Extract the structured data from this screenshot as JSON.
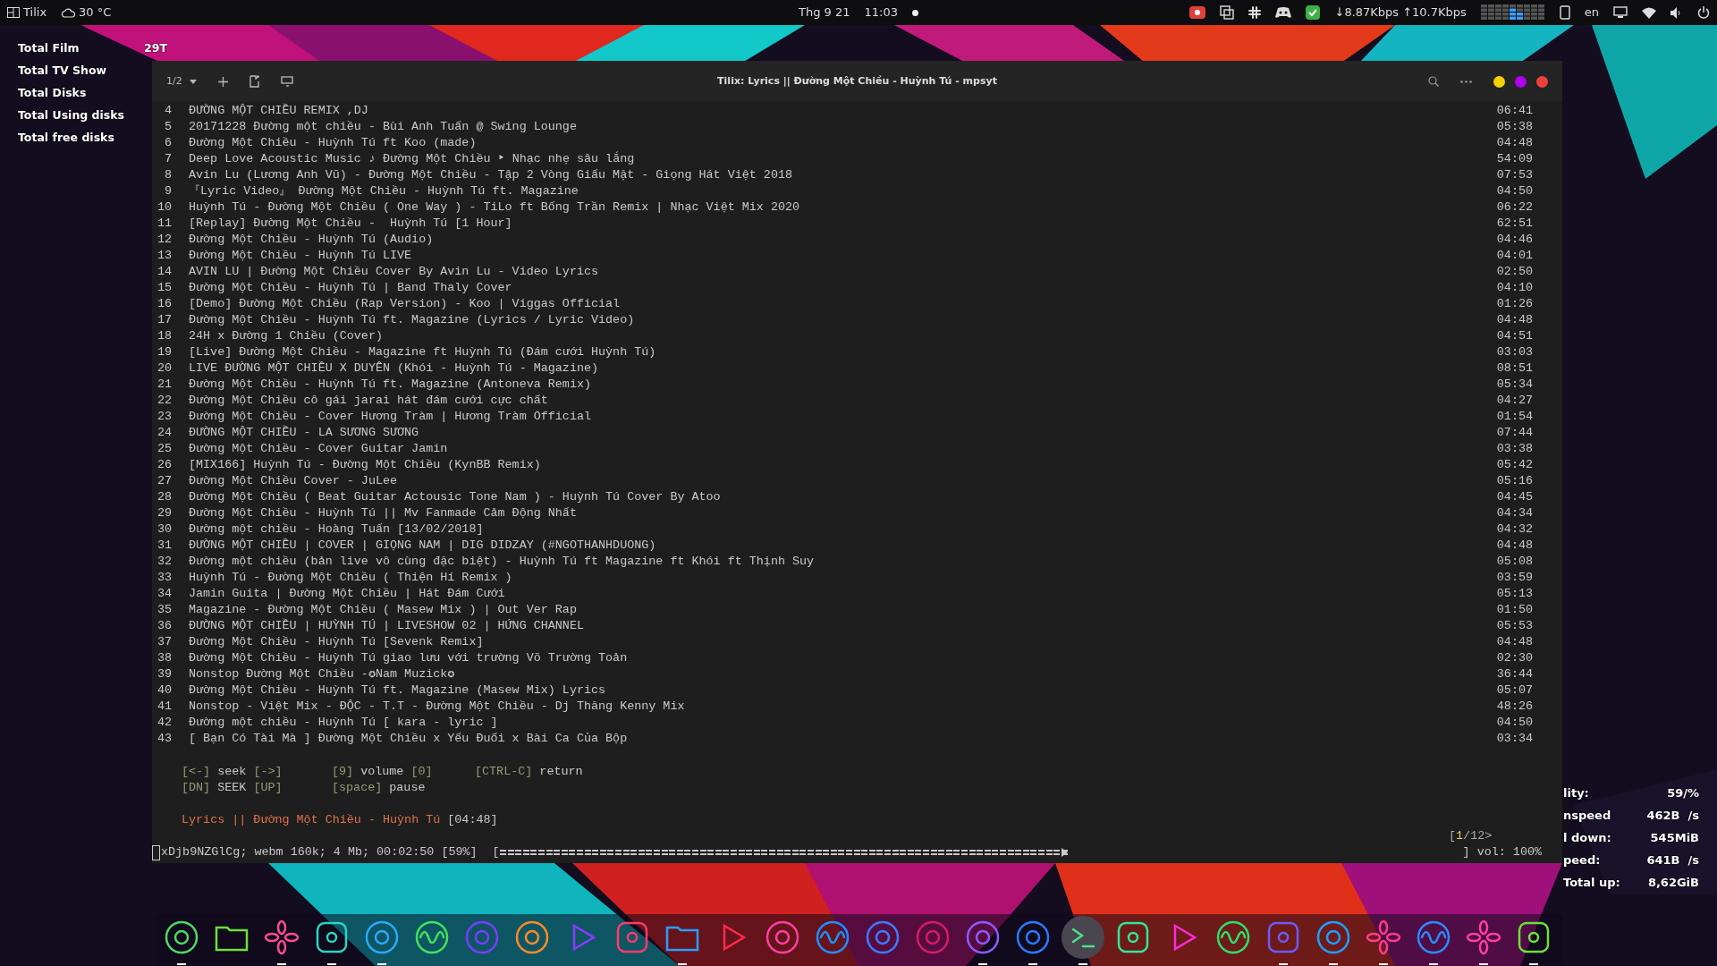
{
  "top_bar": {
    "app": "Tilix",
    "weather": "30 °C",
    "date": "Thg 9 21",
    "time": "11:03",
    "net_down": "↓8.87Kbps",
    "net_up": "↑10.7Kbps",
    "language": "en"
  },
  "desktop_widget": {
    "rows": [
      {
        "label": "Total Film",
        "value": "29T"
      },
      {
        "label": "Total TV Show"
      },
      {
        "label": "Total Disks"
      },
      {
        "label": "Total Using disks"
      },
      {
        "label": "Total free disks"
      }
    ]
  },
  "stats_widget": {
    "rows": [
      {
        "label": "lity:",
        "value": "59/%"
      },
      {
        "label": "nspeed",
        "value": "462B  /s"
      },
      {
        "label": "l down:",
        "value": "545MiB"
      },
      {
        "label": "peed:",
        "value": "641B  /s"
      },
      {
        "label": "Total up:",
        "value": "8,62GiB"
      }
    ]
  },
  "terminal": {
    "session": "1/2",
    "title": "Tilix: Lyrics || Đường Một Chiều - Huỳnh Tú - mpsyt",
    "playlist": [
      {
        "number": "4",
        "title": "ĐƯỜNG MỘT CHIỀU REMIX ,DJ",
        "duration": "06:41"
      },
      {
        "number": "5",
        "title": "20171228 Đường một chiều - Bùi Anh Tuấn @ Swing Lounge",
        "duration": "05:38"
      },
      {
        "number": "6",
        "title": "Đường Một Chiều - Huỳnh Tú ft Koo (made)",
        "duration": "04:48"
      },
      {
        "number": "7",
        "title": "Deep Love Acoustic Music ♪ Đường Một Chiều ‣ Nhạc nhẹ sâu lắng",
        "duration": "54:09"
      },
      {
        "number": "8",
        "title": "Avin Lu (Lương Anh Vũ) - Đường Một Chiều - Tập 2 Vòng Giấu Mặt - Giọng Hát Việt 2018",
        "duration": "07:53"
      },
      {
        "number": "9",
        "title": "『Lyric Video』 Đường Một Chiều - Huỳnh Tú ft. Magazine",
        "duration": "04:50"
      },
      {
        "number": "10",
        "title": "Huỳnh Tú - Đường Một Chiều ( One Way ) - TiLo ft Bống Trần Remix | Nhạc Việt Mix 2020",
        "duration": "06:22"
      },
      {
        "number": "11",
        "title": "[Replay] Đường Một Chiều -  Huỳnh Tú [1 Hour]",
        "duration": "62:51"
      },
      {
        "number": "12",
        "title": "Đường Một Chiều - Huỳnh Tú (Audio)",
        "duration": "04:46"
      },
      {
        "number": "13",
        "title": "Đường Một Chiều - Huỳnh Tú LIVE",
        "duration": "04:01"
      },
      {
        "number": "14",
        "title": "AVIN LU | Đường Một Chiều Cover By Avin Lu - Video Lyrics",
        "duration": "02:50"
      },
      {
        "number": "15",
        "title": "Đường Một Chiều - Huỳnh Tú | Band Thaly Cover",
        "duration": "04:10"
      },
      {
        "number": "16",
        "title": "[Demo] Đường Một Chiều (Rap Version) - Koo | Viggas Official",
        "duration": "01:26"
      },
      {
        "number": "17",
        "title": "Đường Một Chiều - Huỳnh Tú ft. Magazine (Lyrics / Lyric Video)",
        "duration": "04:48"
      },
      {
        "number": "18",
        "title": "24H x Đường 1 Chiều (Cover)",
        "duration": "04:51"
      },
      {
        "number": "19",
        "title": "[Live] Đường Một Chiều - Magazine ft Huỳnh Tú (Đám cưới Huỳnh Tú)",
        "duration": "03:03"
      },
      {
        "number": "20",
        "title": "LIVE ĐƯỜNG MỘT CHIỀU X DUYÊN (Khói - Huỳnh Tú - Magazine)",
        "duration": "08:51"
      },
      {
        "number": "21",
        "title": "Đường Một Chiều - Huỳnh Tú ft. Magazine (Antoneva Remix)",
        "duration": "05:34"
      },
      {
        "number": "22",
        "title": "Đường Một Chiều cô gái jarai hát đám cưới cực chất",
        "duration": "04:27"
      },
      {
        "number": "23",
        "title": "Đường Một Chiều - Cover Hương Tràm | Hương Tràm Official",
        "duration": "01:54"
      },
      {
        "number": "24",
        "title": "ĐƯỜNG MỘT CHIỀU - LA SƯƠNG SƯƠNG",
        "duration": "07:44"
      },
      {
        "number": "25",
        "title": "Đường Một Chiều - Cover Guitar Jamin",
        "duration": "03:38"
      },
      {
        "number": "26",
        "title": "[MIX166] Huỳnh Tú - Đường Một Chiều (KynBB Remix)",
        "duration": "05:42"
      },
      {
        "number": "27",
        "title": "Đường Một Chiều Cover - JuLee",
        "duration": "05:16"
      },
      {
        "number": "28",
        "title": "Đường Một Chiều ( Beat Guitar Actousic Tone Nam ) - Huỳnh Tú Cover By Atoo",
        "duration": "04:45"
      },
      {
        "number": "29",
        "title": "Đường Một Chiều - Huỳnh Tú || Mv Fanmade Cảm Động Nhất",
        "duration": "04:34"
      },
      {
        "number": "30",
        "title": "Đường một chiều - Hoàng Tuấn [13/02/2018]",
        "duration": "04:32"
      },
      {
        "number": "31",
        "title": "ĐƯỜNG MỘT CHIỀU | COVER | GIỌNG NAM | DIG DIDZAY (#NGOTHANHDUONG)",
        "duration": "04:48"
      },
      {
        "number": "32",
        "title": "Đường một chiều (bản live vô cùng đặc biệt) - Huỳnh Tú ft Magazine ft Khói ft Thịnh Suy",
        "duration": "05:08"
      },
      {
        "number": "33",
        "title": "Huỳnh Tú - Đường Một Chiều ( Thiện Hí Remix )",
        "duration": "03:59"
      },
      {
        "number": "34",
        "title": "Jamin Guita | Đường Một Chiều | Hát Đám Cưới",
        "duration": "05:13"
      },
      {
        "number": "35",
        "title": "Magazine - Đường Một Chiều ( Masew Mix ) | Out Ver Rap",
        "duration": "01:50"
      },
      {
        "number": "36",
        "title": "ĐƯỜNG MỘT CHIỀU | HUỲNH TÚ | LIVESHOW 02 | HỨNG CHANNEL",
        "duration": "05:53"
      },
      {
        "number": "37",
        "title": "Đường Một Chiều - Huỳnh Tú [Sevenk Remix]",
        "duration": "04:48"
      },
      {
        "number": "38",
        "title": "Đường Một Chiều - Huỳnh Tú giao lưu với trường Võ Trường Toản",
        "duration": "02:30"
      },
      {
        "number": "39",
        "title": "Nonstop Đường Một Chiều -✪Nam Muzick✪",
        "duration": "36:44"
      },
      {
        "number": "40",
        "title": "Đường Một Chiều - Huỳnh Tú ft. Magazine (Masew Mix) Lyrics",
        "duration": "05:07"
      },
      {
        "number": "41",
        "title": "Nonstop - Việt Mix - ĐỘC - T.T - Đường Một Chiều - Dj Thăng Kenny Mix",
        "duration": "48:26"
      },
      {
        "number": "42",
        "title": "Đường một chiều - Huỳnh Tú [ kara - lyric ]",
        "duration": "04:50"
      },
      {
        "number": "43",
        "title": "[ Bạn Có Tài Mà ] Đường Một Chiều x Yếu Đuối x Bài Ca Của Bộp",
        "duration": "03:34"
      }
    ],
    "hints": [
      [
        {
          "parts": [
            {
              "kind": "key",
              "text": "[<-]"
            },
            {
              "kind": "word",
              "text": "seek"
            },
            {
              "kind": "key",
              "text": "[->]"
            }
          ]
        },
        {
          "parts": [
            {
              "kind": "key",
              "text": "[9]"
            },
            {
              "kind": "word",
              "text": "volume"
            },
            {
              "kind": "key",
              "text": "[0]"
            }
          ]
        },
        {
          "parts": [
            {
              "kind": "key",
              "text": "[CTRL-C]"
            },
            {
              "kind": "word",
              "text": "return"
            }
          ]
        }
      ],
      [
        {
          "parts": [
            {
              "kind": "key",
              "text": "[DN]"
            },
            {
              "kind": "word",
              "text": "SEEK"
            },
            {
              "kind": "key",
              "text": "[UP]"
            }
          ]
        },
        {
          "parts": [
            {
              "kind": "key",
              "text": "[space]"
            },
            {
              "kind": "word",
              "text": "pause"
            }
          ]
        }
      ]
    ],
    "now_playing": {
      "title": "Lyrics || Đường Một Chiều - Huỳnh Tú",
      "duration": "[04:48]"
    },
    "page": {
      "open": "[",
      "current": "1",
      "rest": "/12>"
    },
    "status": {
      "info": "xDjb9NZGlCg; webm 160k; 4 Mb; 00:02:50 [59%]",
      "open": "[",
      "level": 0.59,
      "close": "] vol: 100%"
    }
  },
  "dock": [
    {
      "running": true,
      "highlighted": false
    },
    {
      "running": false,
      "highlighted": false
    },
    {
      "running": true,
      "highlighted": false
    },
    {
      "running": true,
      "highlighted": false
    },
    {
      "running": true,
      "highlighted": false
    },
    {
      "running": false,
      "highlighted": false
    },
    {
      "running": false,
      "highlighted": false
    },
    {
      "running": false,
      "highlighted": false
    },
    {
      "running": false,
      "highlighted": false
    },
    {
      "running": false,
      "highlighted": false
    },
    {
      "running": true,
      "highlighted": false
    },
    {
      "running": false,
      "highlighted": false
    },
    {
      "running": false,
      "highlighted": false
    },
    {
      "running": false,
      "highlighted": false
    },
    {
      "running": false,
      "highlighted": false
    },
    {
      "running": false,
      "highlighted": false
    },
    {
      "running": true,
      "highlighted": false
    },
    {
      "running": true,
      "highlighted": false
    },
    {
      "running": true,
      "highlighted": true
    },
    {
      "running": false,
      "highlighted": false
    },
    {
      "running": false,
      "highlighted": false
    },
    {
      "running": false,
      "highlighted": false
    },
    {
      "running": true,
      "highlighted": false
    },
    {
      "running": true,
      "highlighted": false
    },
    {
      "running": true,
      "highlighted": false
    },
    {
      "running": true,
      "highlighted": false
    },
    {
      "running": true,
      "highlighted": false
    },
    {
      "running": true,
      "highlighted": false
    }
  ]
}
